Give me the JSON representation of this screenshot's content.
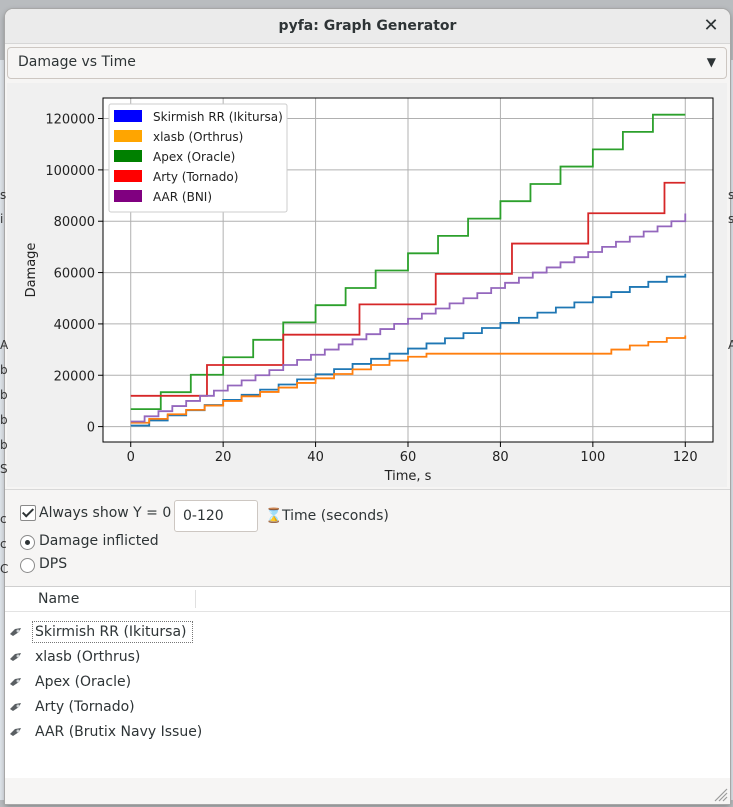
{
  "window": {
    "title": "pyfa: Graph Generator"
  },
  "background": {
    "left_letters": [
      "s",
      "i",
      "A",
      "b",
      "b",
      "b",
      "b",
      "S",
      "c",
      "c",
      "C"
    ],
    "right_letters": [
      "s",
      "s",
      "A"
    ]
  },
  "graph_selector": {
    "value": "Damage vs Time"
  },
  "chart_data": {
    "type": "line",
    "step": true,
    "title": "",
    "xlabel": "Time, s",
    "ylabel": "Damage",
    "xlim": [
      -6,
      126
    ],
    "ylim": [
      -6000,
      128000
    ],
    "x_ticks": [
      0,
      20,
      40,
      60,
      80,
      100,
      120
    ],
    "y_ticks": [
      0,
      20000,
      40000,
      60000,
      80000,
      100000,
      120000
    ],
    "grid": true,
    "legend_position": "top-left",
    "series": [
      {
        "name": "Skirmish RR (Ikitursa)",
        "color": "#0000ff",
        "line_color": "#1f77b4",
        "step_interval": 4,
        "step_size": 2000,
        "end": [
          120,
          59500
        ],
        "start": [
          0,
          400
        ]
      },
      {
        "name": "xlasb (Orthrus)",
        "color": "#ffa500",
        "line_color": "#ff7f0e",
        "points": [
          [
            0,
            1500
          ],
          [
            4,
            3000
          ],
          [
            8,
            4800
          ],
          [
            12,
            6500
          ],
          [
            16,
            8200
          ],
          [
            20,
            10000
          ],
          [
            24,
            11800
          ],
          [
            28,
            13500
          ],
          [
            32,
            15200
          ],
          [
            36,
            17000
          ],
          [
            40,
            18800
          ],
          [
            44,
            20500
          ],
          [
            48,
            22300
          ],
          [
            52,
            24000
          ],
          [
            56,
            25700
          ],
          [
            60,
            27200
          ],
          [
            64,
            28400
          ],
          [
            100,
            28400
          ],
          [
            104,
            30000
          ],
          [
            108,
            31600
          ],
          [
            112,
            33000
          ],
          [
            116,
            34500
          ],
          [
            120,
            35500
          ]
        ]
      },
      {
        "name": "Apex (Oracle)",
        "color": "#008000",
        "line_color": "#2ca02c",
        "points": [
          [
            0,
            6800
          ],
          [
            6.5,
            13400
          ],
          [
            13,
            20200
          ],
          [
            20,
            27000
          ],
          [
            26.5,
            33800
          ],
          [
            33,
            40600
          ],
          [
            40,
            47300
          ],
          [
            46.5,
            54000
          ],
          [
            53,
            60800
          ],
          [
            60,
            67500
          ],
          [
            66.5,
            74300
          ],
          [
            73,
            81000
          ],
          [
            80,
            87800
          ],
          [
            86.5,
            94500
          ],
          [
            93,
            101300
          ],
          [
            100,
            108000
          ],
          [
            106.5,
            114800
          ],
          [
            113,
            121500
          ],
          [
            120,
            121500
          ]
        ]
      },
      {
        "name": "Arty (Tornado)",
        "color": "#ff0000",
        "line_color": "#d62728",
        "points": [
          [
            0,
            12000
          ],
          [
            16.5,
            24000
          ],
          [
            33,
            35800
          ],
          [
            49.5,
            47600
          ],
          [
            66,
            59500
          ],
          [
            82.5,
            71300
          ],
          [
            99,
            83100
          ],
          [
            115.5,
            95000
          ],
          [
            120,
            95000
          ]
        ]
      },
      {
        "name": "AAR (BNI)",
        "color": "#800080",
        "line_color": "#9467bd",
        "step_interval": 3,
        "step_size": 2000,
        "end": [
          120,
          83000
        ],
        "start": [
          0,
          2000
        ]
      }
    ]
  },
  "controls": {
    "always_show_y0_label": "Always show Y = 0",
    "always_show_y0_checked": true,
    "x_range_value": "0-120",
    "x_range_label": "Time (seconds)",
    "y_mode_options": [
      "Damage inflicted",
      "DPS"
    ],
    "y_mode_selected": "Damage inflicted"
  },
  "fit_list": {
    "header": "Name",
    "rows": [
      "Skirmish RR (Ikitursa)",
      "xlasb (Orthrus)",
      "Apex (Oracle)",
      "Arty (Tornado)",
      "AAR (Brutix Navy Issue)"
    ]
  }
}
